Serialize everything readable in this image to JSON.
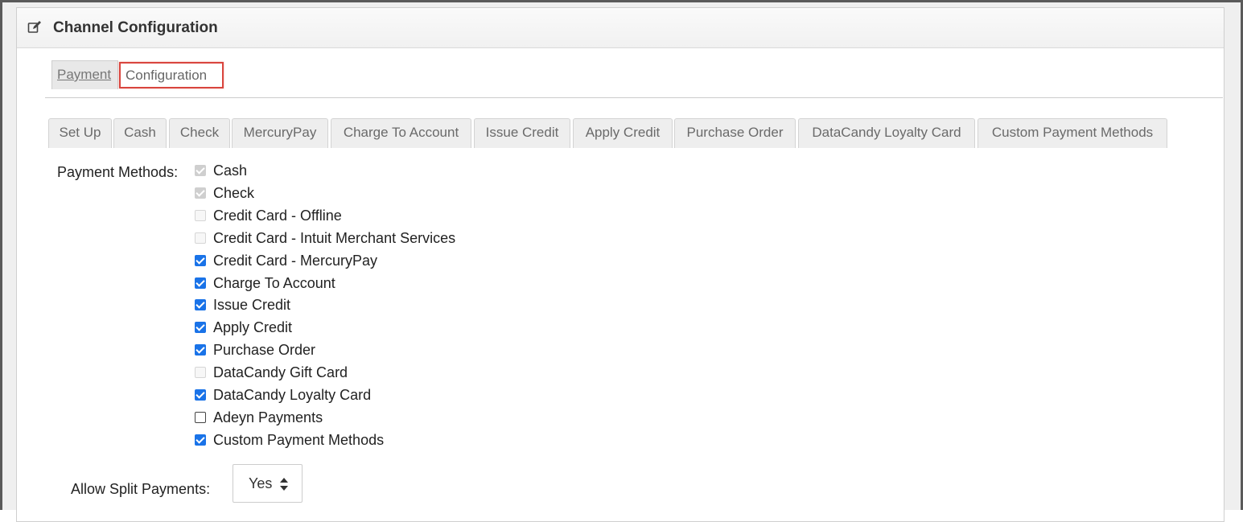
{
  "panel": {
    "title": "Channel Configuration"
  },
  "top_tabs": [
    {
      "label": "Payment"
    },
    {
      "label": "Configuration"
    }
  ],
  "sub_tabs": [
    {
      "label": "Set Up"
    },
    {
      "label": "Cash"
    },
    {
      "label": "Check"
    },
    {
      "label": "MercuryPay"
    },
    {
      "label": "Charge To Account"
    },
    {
      "label": "Issue Credit"
    },
    {
      "label": "Apply Credit"
    },
    {
      "label": "Purchase Order"
    },
    {
      "label": "DataCandy Loyalty Card"
    },
    {
      "label": "Custom Payment Methods"
    }
  ],
  "payment_methods": {
    "label": "Payment Methods:",
    "items": [
      {
        "label": "Cash",
        "checked": true,
        "disabled": true
      },
      {
        "label": "Check",
        "checked": true,
        "disabled": true
      },
      {
        "label": "Credit Card - Offline",
        "checked": false,
        "disabled": true
      },
      {
        "label": "Credit Card - Intuit Merchant Services",
        "checked": false,
        "disabled": true
      },
      {
        "label": "Credit Card - MercuryPay",
        "checked": true,
        "disabled": false
      },
      {
        "label": "Charge To Account",
        "checked": true,
        "disabled": false
      },
      {
        "label": "Issue Credit",
        "checked": true,
        "disabled": false
      },
      {
        "label": "Apply Credit",
        "checked": true,
        "disabled": false
      },
      {
        "label": "Purchase Order",
        "checked": true,
        "disabled": false
      },
      {
        "label": "DataCandy Gift Card",
        "checked": false,
        "disabled": true
      },
      {
        "label": "DataCandy Loyalty Card",
        "checked": true,
        "disabled": false
      },
      {
        "label": "Adeyn Payments",
        "checked": false,
        "disabled": false
      },
      {
        "label": "Custom Payment Methods",
        "checked": true,
        "disabled": false
      }
    ]
  },
  "split_payments": {
    "label": "Allow Split Payments:",
    "value": "Yes"
  },
  "colors": {
    "highlight_border": "#d9453e",
    "checkbox_checked": "#1a73e8",
    "checkbox_disabled": "#cfcfcf"
  }
}
